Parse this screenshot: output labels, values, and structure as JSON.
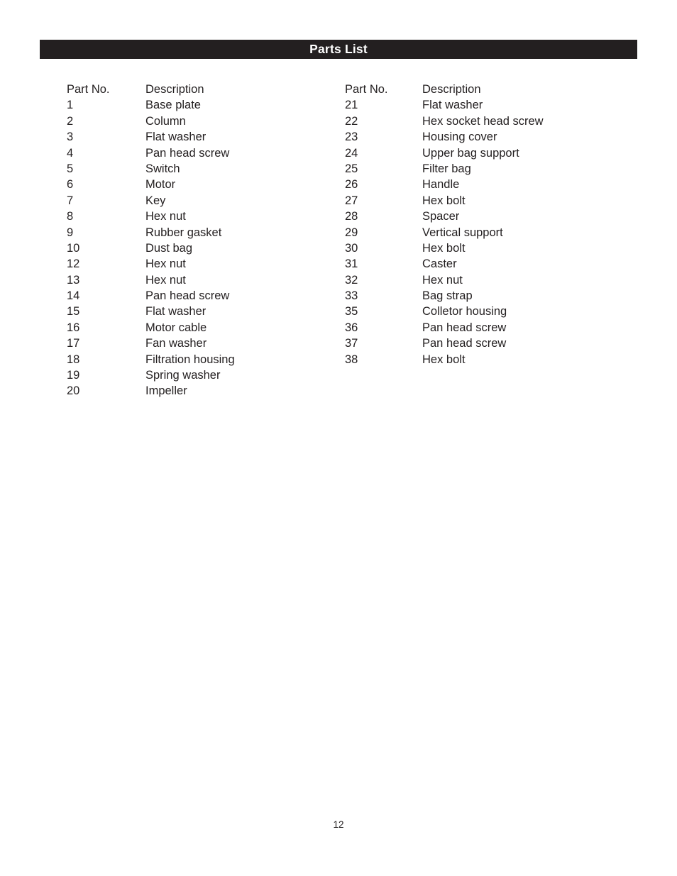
{
  "document": {
    "title_bar_label": "Parts List",
    "page_number": "12",
    "colors": {
      "title_bar_background": "#231f20",
      "title_bar_text": "#ffffff",
      "body_text": "#231f20",
      "page_background": "#ffffff"
    }
  },
  "table": {
    "headers": {
      "part_no": "Part No.",
      "description": "Description"
    },
    "left_column": [
      {
        "no": "1",
        "desc": "Base plate"
      },
      {
        "no": "2",
        "desc": "Column"
      },
      {
        "no": "3",
        "desc": "Flat washer"
      },
      {
        "no": "4",
        "desc": "Pan head screw"
      },
      {
        "no": "5",
        "desc": "Switch"
      },
      {
        "no": "6",
        "desc": "Motor"
      },
      {
        "no": "7",
        "desc": "Key"
      },
      {
        "no": "8",
        "desc": "Hex nut"
      },
      {
        "no": "9",
        "desc": "Rubber gasket"
      },
      {
        "no": "10",
        "desc": "Dust bag"
      },
      {
        "no": "12",
        "desc": "Hex nut"
      },
      {
        "no": "13",
        "desc": "Hex nut"
      },
      {
        "no": "14",
        "desc": "Pan head screw"
      },
      {
        "no": "15",
        "desc": "Flat washer"
      },
      {
        "no": "16",
        "desc": "Motor cable"
      },
      {
        "no": "17",
        "desc": "Fan washer"
      },
      {
        "no": "18",
        "desc": "Filtration housing"
      },
      {
        "no": "19",
        "desc": "Spring washer"
      },
      {
        "no": "20",
        "desc": "Impeller"
      }
    ],
    "right_column": [
      {
        "no": "21",
        "desc": "Flat washer"
      },
      {
        "no": "22",
        "desc": "Hex socket head screw"
      },
      {
        "no": "23",
        "desc": "Housing cover"
      },
      {
        "no": "24",
        "desc": "Upper bag support"
      },
      {
        "no": "25",
        "desc": "Filter bag"
      },
      {
        "no": "26",
        "desc": "Handle"
      },
      {
        "no": "27",
        "desc": "Hex bolt"
      },
      {
        "no": "28",
        "desc": "Spacer"
      },
      {
        "no": "29",
        "desc": "Vertical support"
      },
      {
        "no": "30",
        "desc": "Hex bolt"
      },
      {
        "no": "31",
        "desc": "Caster"
      },
      {
        "no": "32",
        "desc": "Hex nut"
      },
      {
        "no": "33",
        "desc": "Bag strap"
      },
      {
        "no": "35",
        "desc": "Colletor housing"
      },
      {
        "no": "36",
        "desc": "Pan head screw"
      },
      {
        "no": "37",
        "desc": "Pan head screw"
      },
      {
        "no": "38",
        "desc": "Hex bolt"
      }
    ]
  }
}
